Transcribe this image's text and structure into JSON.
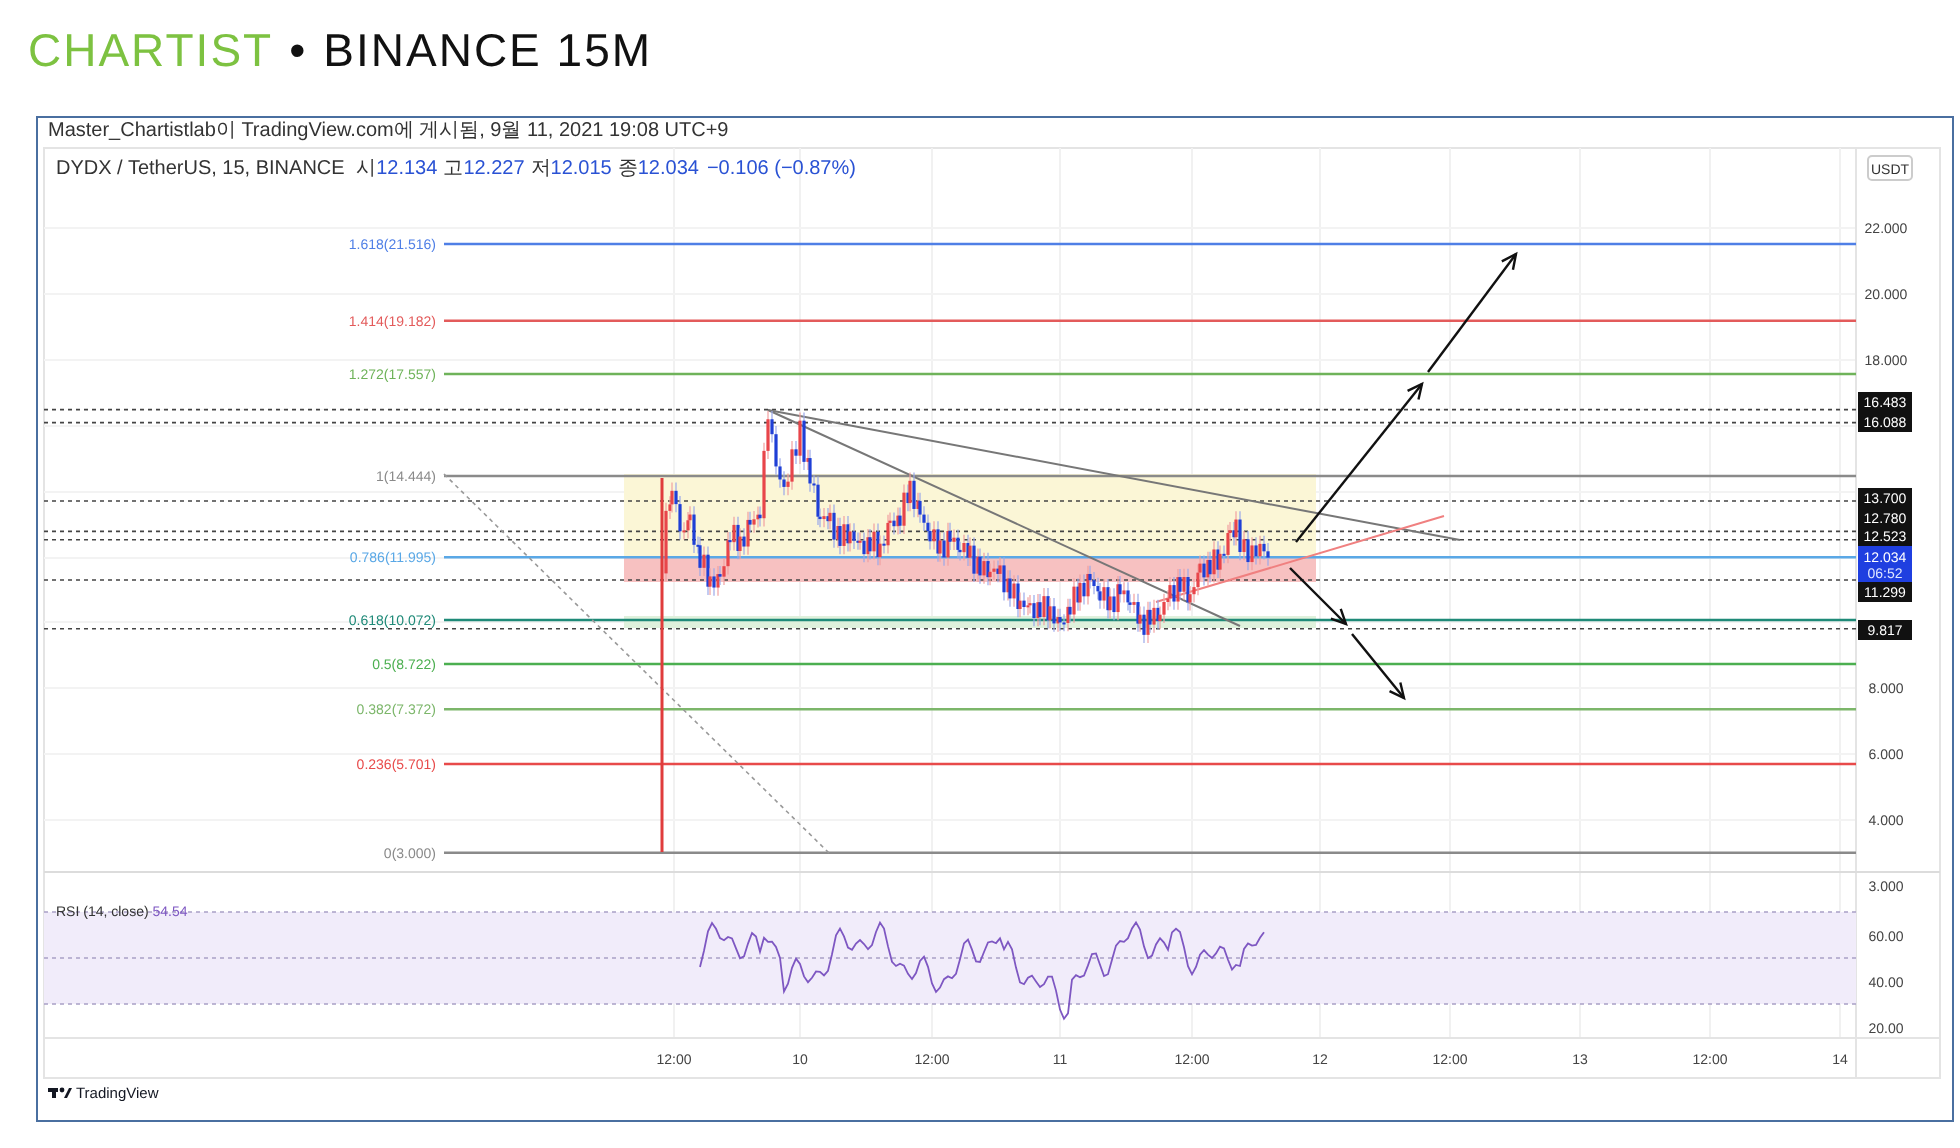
{
  "title": {
    "brand": "CHARTIST",
    "separator": "•",
    "text": "BINANCE 15M"
  },
  "publisher": "Master_Chartistlab이 TradingView.com에 게시됨, 9월 11, 2021 19:08 UTC+9",
  "legend": {
    "symbol": "DYDX / TetherUS, 15, BINANCE",
    "ohlc": [
      {
        "label": "시",
        "value": "12.134"
      },
      {
        "label": "고",
        "value": "12.227"
      },
      {
        "label": "저",
        "value": "12.015"
      },
      {
        "label": "종",
        "value": "12.034"
      }
    ],
    "change": "−0.106 (−0.87%)"
  },
  "currency": "USDT",
  "fib_levels": [
    {
      "label": "1.618(21.516)",
      "color": "#4f7fe6"
    },
    {
      "label": "1.414(19.182)",
      "color": "#e35b5b"
    },
    {
      "label": "1.272(17.557)",
      "color": "#6fb35a"
    },
    {
      "label": "1(14.444)",
      "color": "#8a8a8a"
    },
    {
      "label": "0.786(11.995)",
      "color": "#5aa8e6"
    },
    {
      "label": "0.618(10.072)",
      "color": "#1f8a78"
    },
    {
      "label": "0.5(8.722)",
      "color": "#4caf50"
    },
    {
      "label": "0.382(7.372)",
      "color": "#7cb66a"
    },
    {
      "label": "0.236(5.701)",
      "color": "#e84a4a"
    },
    {
      "label": "0(3.000)",
      "color": "#8a8a8a"
    }
  ],
  "price_scale": [
    "22.000",
    "20.000",
    "18.000",
    "8.000",
    "6.000",
    "4.000",
    "3.000"
  ],
  "level_badges": [
    "16.483",
    "16.088",
    "13.700",
    "12.780",
    "12.523",
    "11.299",
    "9.817"
  ],
  "last_price": {
    "value": "12.034",
    "countdown": "06:52"
  },
  "rsi": {
    "label": "RSI (14, close)",
    "value": "54.54",
    "scale": [
      "60.00",
      "40.00",
      "20.00"
    ]
  },
  "time_axis": [
    "12:00",
    "10",
    "12:00",
    "11",
    "12:00",
    "12",
    "12:00",
    "13",
    "12:00",
    "14"
  ],
  "footer": "TradingView"
}
